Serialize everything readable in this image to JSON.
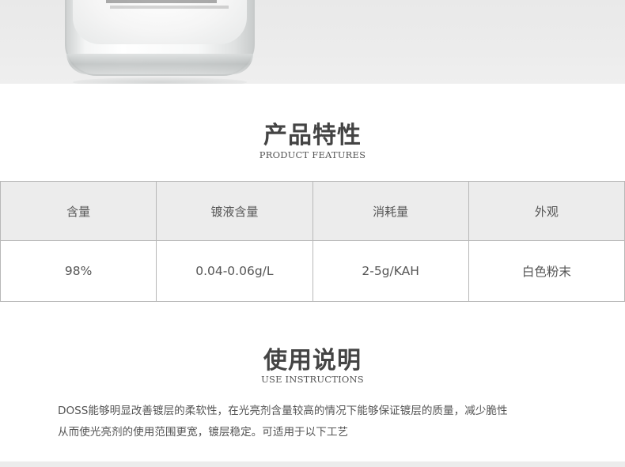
{
  "hero": {
    "product_image": "jar-of-white-powder"
  },
  "features": {
    "title": "产品特性",
    "subtitle": "PRODUCT FEATURES",
    "table": {
      "headers": [
        "含量",
        "镀液含量",
        "消耗量",
        "外观"
      ],
      "values": [
        "98%",
        "0.04-0.06g/L",
        "2-5g/KAH",
        "白色粉末"
      ]
    }
  },
  "instructions": {
    "title": "使用说明",
    "subtitle": "USE INSTRUCTIONS",
    "lines": [
      "DOSS能够明显改善镀层的柔软性，在光亮剂含量较高的情况下能够保证镀层的质量，减少脆性",
      "从而使光亮剂的使用范围更宽，镀层稳定。可适用于以下工艺"
    ]
  },
  "colors": {
    "header_bg": "#ececec",
    "border": "#b8b8b8",
    "title": "#444444",
    "text": "#555555"
  }
}
